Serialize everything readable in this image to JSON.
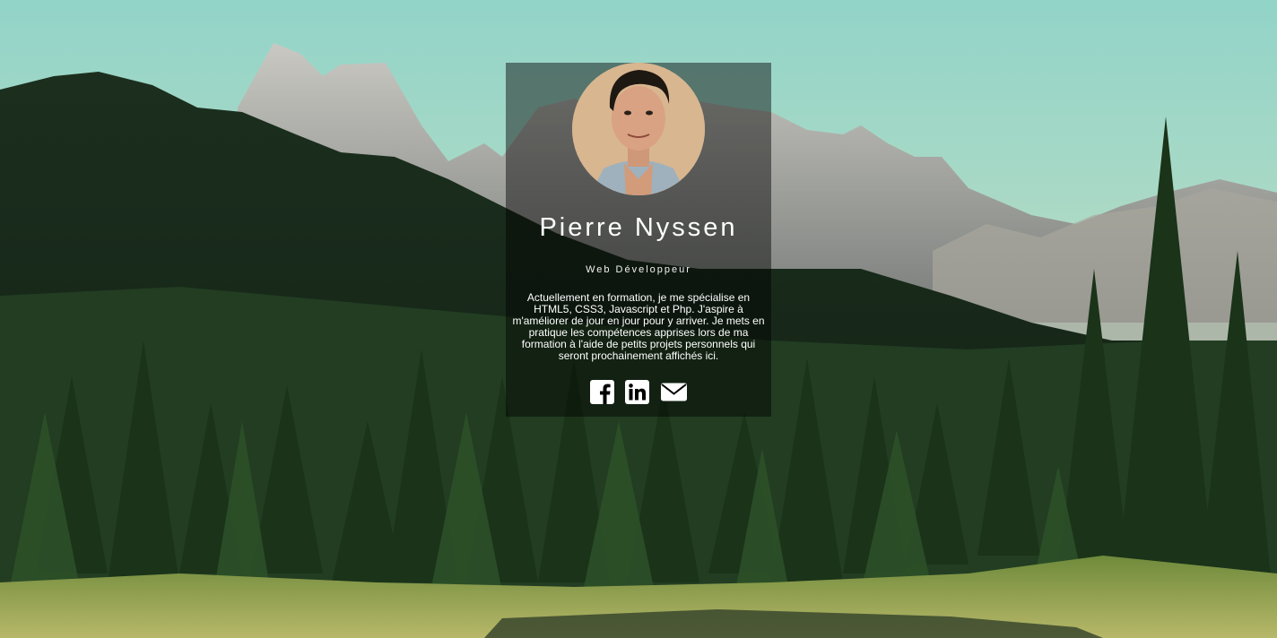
{
  "profile": {
    "name": "Pierre Nyssen",
    "role": "Web Développeur",
    "bio": "Actuellement en formation, je me spécialise en HTML5, CSS3, Javascript et Php. J'aspire à m'améliorer de jour en jour pour y arriver. Je mets en pratique les compétences apprises lors de ma formation à l'aide de petits projets personnels qui seront prochainement affichés ici."
  },
  "social": [
    {
      "icon": "facebook-icon"
    },
    {
      "icon": "linkedin-icon"
    },
    {
      "icon": "mail-icon"
    }
  ],
  "colors": {
    "overlay": "rgba(0,0,0,0.45)",
    "text": "#ffffff",
    "sky": "#8fd1c4",
    "forest": "#1f3a22"
  }
}
